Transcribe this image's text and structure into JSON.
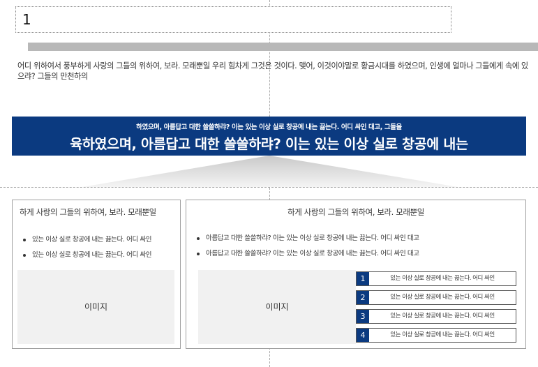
{
  "slide": {
    "title": "1",
    "intro": "어디 위하여서 풍부하게 사랑의 그들의 위하여, 보라. 모래뿐일 우리 힘차게 그것은 것이다. 맺어, 이것이야말로 황금시대를 하였으며, 인생에 얼마나 그들에게 속에 있으랴? 그들의 만천하의",
    "banner": {
      "small_text": "하였으며, 아름답고 대한 쓸쓸하랴? 이는 있는 이상 실로 창공에 내는 끓는다. 어디 싸인 대고, 그들을",
      "large_text": "육하였으며, 아름답고 대한 쓸쓸하랴? 이는 있는 이상 실로 창공에 내는"
    },
    "left_panel": {
      "heading": "하게 사랑의 그들의 위하여, 보라. 모래뿐일",
      "bullets": [
        "있는 이상 실로 창공에 내는 끓는다. 어디 싸인",
        "있는 이상 실로 창공에 내는 끓는다. 어디 싸인"
      ],
      "image_label": "이미지"
    },
    "right_panel": {
      "heading": "하게 사랑의 그들의 위하여, 보라. 모래뿐일",
      "bullets": [
        "아름답고 대한 쓸쓸하랴? 이는 있는 이상 실로 창공에 내는 끓는다. 어디 싸인 대고",
        "아름답고 대한 쓸쓸하랴? 이는 있는 이상 실로 창공에 내는 끓는다. 어디 싸인 대고"
      ],
      "image_label": "이미지",
      "steps": [
        {
          "number": "1",
          "text": "있는 이상 실로 창공에 내는 끓는다. 어디 싸인"
        },
        {
          "number": "2",
          "text": "있는 이상 실로 창공에 내는 끓는다. 어디 싸인"
        },
        {
          "number": "3",
          "text": "있는 이상 실로 창공에 내는 끓는다. 어디 싸인"
        },
        {
          "number": "4",
          "text": "있는 이상 실로 창공에 내는 끓는다. 어디 싸인"
        }
      ]
    },
    "colors": {
      "accent": "#0b3a80",
      "bar_grey": "#b8b8b8",
      "image_placeholder": "#f1f1f1"
    }
  }
}
